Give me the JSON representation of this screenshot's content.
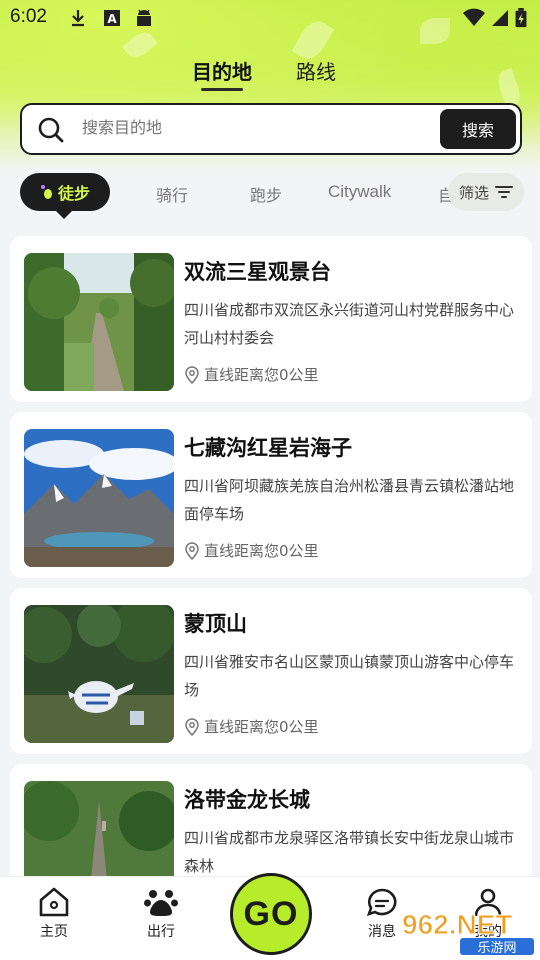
{
  "status_bar": {
    "time": "6:02",
    "left_icons": [
      "download-icon",
      "font-icon",
      "android-icon"
    ],
    "right_icons": [
      "wifi-icon",
      "signal-icon",
      "battery-charging-icon"
    ]
  },
  "tabs": [
    {
      "label": "目的地",
      "active": true
    },
    {
      "label": "路线",
      "active": false
    }
  ],
  "search": {
    "placeholder": "搜索目的地",
    "button_label": "搜索"
  },
  "categories": {
    "active": "徒步",
    "items": [
      "骑行",
      "跑步",
      "Citywalk",
      "自"
    ],
    "filter_label": "筛选"
  },
  "places": [
    {
      "title": "双流三星观景台",
      "address": "四川省成都市双流区永兴街道河山村党群服务中心河山村村委会",
      "distance": "直线距离您0公里"
    },
    {
      "title": "七藏沟红星岩海子",
      "address": "四川省阿坝藏族羌族自治州松潘县青云镇松潘站地面停车场",
      "distance": "直线距离您0公里"
    },
    {
      "title": "蒙顶山",
      "address": "四川省雅安市名山区蒙顶山镇蒙顶山游客中心停车场",
      "distance": "直线距离您0公里"
    },
    {
      "title": "洛带金龙长城",
      "address": "四川省成都市龙泉驿区洛带镇长安中街龙泉山城市森林",
      "distance": ""
    }
  ],
  "navbar": {
    "home": "主页",
    "travel": "出行",
    "go": "GO",
    "messages": "消息",
    "profile": "我的"
  },
  "watermark": {
    "brand": "962.NET",
    "subtitle": "乐游网"
  },
  "colors": {
    "accent": "#b6ec2a",
    "dark": "#1d1d1d",
    "hero": "#c9f049"
  }
}
